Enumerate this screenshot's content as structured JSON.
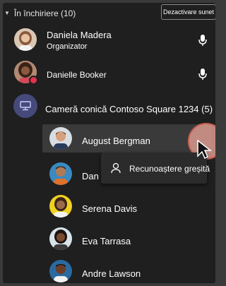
{
  "lobby": {
    "header": "În închiriere (10)",
    "mute_all": "Dezactivare sunet"
  },
  "participants": [
    {
      "name": "Daniela Madera",
      "role": "Organizator",
      "avatar_icon": "person-photo-icon",
      "mic_icon": "microphone-icon"
    },
    {
      "name": "Danielle Booker",
      "avatar_icon": "person-photo-icon",
      "mic_icon": "microphone-icon",
      "status": "presence-busy"
    },
    {
      "name": "Cameră conică Contoso Square 1234 (5)",
      "avatar_icon": "conference-room-icon"
    },
    {
      "name": "August Bergman",
      "avatar_icon": "person-photo-icon"
    },
    {
      "name": "Dan",
      "avatar_icon": "person-photo-icon"
    },
    {
      "name": "Serena Davis",
      "avatar_icon": "person-photo-icon"
    },
    {
      "name": "Eva Tarrasa",
      "avatar_icon": "person-photo-icon"
    },
    {
      "name": "Andre Lawson",
      "avatar_icon": "person-photo-icon"
    }
  ],
  "context_menu": {
    "item_label": "Recunoaștere greșită",
    "item_icon": "person-alert-icon"
  },
  "colors": {
    "panel_bg": "#1f1f1f",
    "hover_bg": "#3a3a3a",
    "room_badge": "#454a7a",
    "presence_red": "#e0334c",
    "highlight_circle": "#e36a55"
  }
}
